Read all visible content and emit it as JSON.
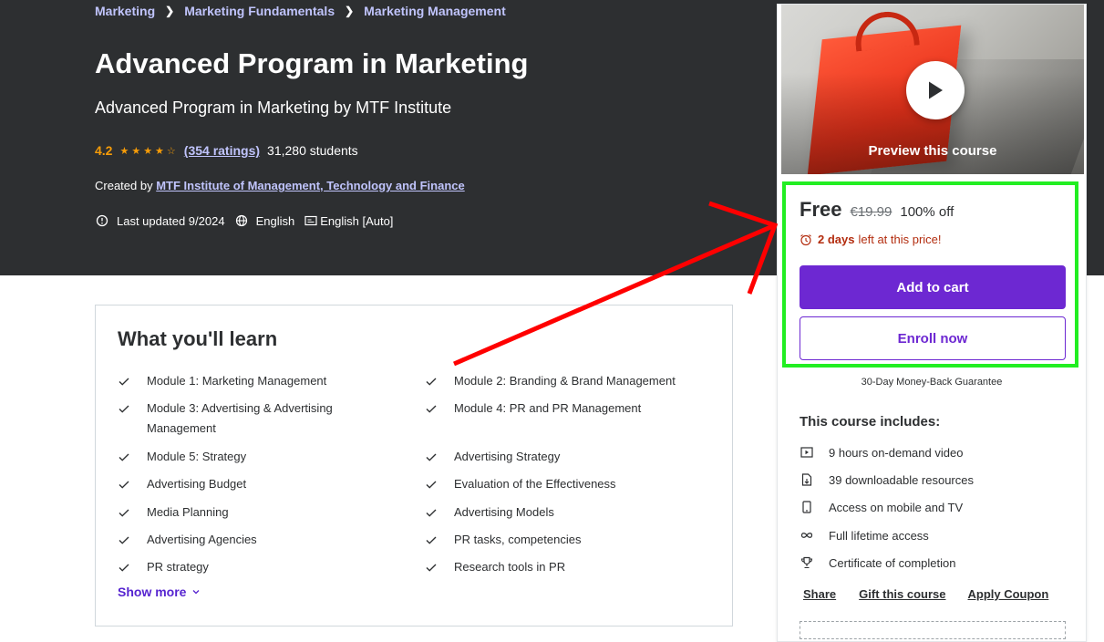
{
  "breadcrumb": [
    "Marketing",
    "Marketing Fundamentals",
    "Marketing Management"
  ],
  "course": {
    "title": "Advanced Program in Marketing",
    "subtitle": "Advanced Program in Marketing by MTF Institute",
    "rating": "4.2",
    "rating_value": 4.2,
    "ratings_count": "(354 ratings)",
    "students": "31,280 students",
    "created_by_label": "Created by",
    "instructor": "MTF Institute of Management, Technology and Finance",
    "last_updated": "Last updated 9/2024",
    "language": "English",
    "captions": "English [Auto]"
  },
  "learn": {
    "title": "What you'll learn",
    "items": [
      "Module 1: Marketing Management",
      "Module 2: Branding & Brand Management",
      "Module 3: Advertising & Advertising Management",
      "Module 4: PR and PR Management",
      "Module 5: Strategy",
      "Advertising Strategy",
      "Advertising Budget",
      "Evaluation of the Effectiveness",
      "Media Planning",
      "Advertising Models",
      "Advertising Agencies",
      "PR tasks, competencies",
      "PR strategy",
      "Research tools in PR"
    ],
    "show_more": "Show more"
  },
  "sidebar": {
    "preview_label": "Preview this course",
    "price": "Free",
    "original_price": "€19.99",
    "discount": "100% off",
    "timer_bold": "2 days",
    "timer_text": "left at this price!",
    "add_to_cart": "Add to cart",
    "enroll_now": "Enroll now",
    "guarantee": "30-Day Money-Back Guarantee",
    "includes_title": "This course includes:",
    "includes": [
      {
        "icon": "video-icon",
        "text": "9 hours on-demand video"
      },
      {
        "icon": "file-download-icon",
        "text": "39 downloadable resources"
      },
      {
        "icon": "mobile-icon",
        "text": "Access on mobile and TV"
      },
      {
        "icon": "infinity-icon",
        "text": "Full lifetime access"
      },
      {
        "icon": "trophy-icon",
        "text": "Certificate of completion"
      }
    ],
    "share": "Share",
    "gift": "Gift this course",
    "coupon": "Apply Coupon"
  },
  "colors": {
    "hero_bg": "#2d2f31",
    "accent": "#6d28d2",
    "star": "#f69c08",
    "link_light": "#c0c4fc",
    "highlight": "#22ee22",
    "annotation_arrow": "#ff0000"
  }
}
